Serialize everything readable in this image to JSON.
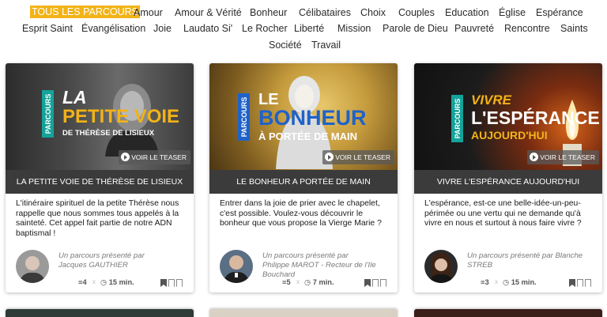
{
  "filters": [
    {
      "label": "TOUS LES PARCOURS",
      "active": true
    },
    {
      "label": "Amour"
    },
    {
      "label": "Amour & Vérité"
    },
    {
      "label": "Bonheur"
    },
    {
      "label": "Célibataires"
    },
    {
      "label": "Choix"
    },
    {
      "label": "Couples"
    },
    {
      "label": "Education"
    },
    {
      "label": "Église"
    },
    {
      "label": "Espérance"
    },
    {
      "label": "Esprit Saint"
    },
    {
      "label": "Évangélisation"
    },
    {
      "label": "Joie"
    },
    {
      "label": "Laudato Si'"
    },
    {
      "label": "Le Rocher"
    },
    {
      "label": "Liberté"
    },
    {
      "label": "Mission"
    },
    {
      "label": "Parole de Dieu"
    },
    {
      "label": "Pauvreté"
    },
    {
      "label": "Rencontre"
    },
    {
      "label": "Saints"
    },
    {
      "label": "Société"
    },
    {
      "label": "Travail"
    }
  ],
  "cards": [
    {
      "tag": "PARCOURS",
      "title_line1": "LA",
      "title_line2": "PETITE VOIE",
      "title_line3": "DE THÉRÈSE DE LISIEUX",
      "teaser": "VOIR LE TEASER",
      "caption": "LA PETITE VOIE DE THÉRÈSE DE LISIEUX",
      "description": "L'itinéraire spirituel de la petite Thérèse nous rappelle que nous sommes tous appelés à la sainteté. Cet appel fait partie de notre ADN baptismal !",
      "presenter_prefix": "Un parcours présenté par",
      "presenter_name": "Jacques GAUTHIER",
      "episodes": "4",
      "duration": "15 min.",
      "accent": "#f2b317"
    },
    {
      "tag": "PARCOURS",
      "title_line1": "LE",
      "title_line2": "BONHEUR",
      "title_line3": "À PORTÉE DE MAIN",
      "teaser": "VOIR LE TEASER",
      "caption": "LE BONHEUR A PORTÉE DE MAIN",
      "description": "Entrer dans la joie de prier avec le chapelet, c'est possible. Voulez-vous découvrir le bonheur que vous propose la Vierge Marie ?",
      "presenter_prefix": "Un parcours présenté par",
      "presenter_name": "Philippe MAROT - Recteur de l'Ile Bouchard",
      "episodes": "5",
      "duration": "7 min.",
      "accent": "#1f62c9"
    },
    {
      "tag": "PARCOURS",
      "title_line1": "VIVRE",
      "title_line2": "L'ESPÉRANCE",
      "title_line3": "AUJOURD'HUI",
      "teaser": "VOIR LE TEASER",
      "caption": "VIVRE L'ESPÉRANCE AUJOURD'HUI",
      "description": "L'espérance, est-ce une belle-idée-un-peu-périmée ou une vertu qui ne demande qu'à vivre en nous et surtout à nous faire vivre ?",
      "presenter_prefix": "Un parcours présenté par Blanche",
      "presenter_name": "STREB",
      "episodes": "3",
      "duration": "15 min.",
      "accent": "#f2b317"
    }
  ],
  "colors": {
    "active_filter": "#f2b317",
    "parcours_tag": "#14a39a",
    "caption_bg": "#3b3b3b"
  }
}
